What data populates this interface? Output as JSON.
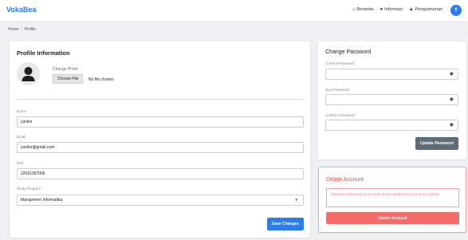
{
  "header": {
    "brand": "VokaBea",
    "nav": [
      {
        "label": "Beranda",
        "icon": "home-icon"
      },
      {
        "label": "Informasi",
        "icon": "info-icon"
      },
      {
        "label": "Pengumuman",
        "icon": "megaphone-icon"
      }
    ],
    "avatar_initial": "Y"
  },
  "breadcrumb": {
    "home": "Home",
    "separator": "/",
    "current": "Profile"
  },
  "profile": {
    "title": "Profile Information",
    "photo_label": "Change Photo",
    "choose_file": "Choose File",
    "file_status": "No file chosen",
    "fields": {
      "name": {
        "label": "Name",
        "value": "yunike"
      },
      "email": {
        "label": "Email",
        "value": "yunike@gmail.com"
      },
      "nim": {
        "label": "NIM",
        "value": "22091397006"
      },
      "program": {
        "label": "Study Program",
        "value": "Manajemen Informatika"
      }
    },
    "save_label": "Save Changes"
  },
  "password": {
    "title": "Change Password",
    "current_label": "Current Password",
    "new_label": "New Password",
    "confirm_label": "Confirm Password",
    "update_label": "Update Password"
  },
  "delete": {
    "title": "Delete Account",
    "warning": "Warning: Deleting your account is permanent and cannot be undone.",
    "button_label": "Delete Account"
  },
  "colors": {
    "primary": "#2b7de9",
    "danger": "#f36b6b",
    "secondary": "#5f6b76"
  }
}
